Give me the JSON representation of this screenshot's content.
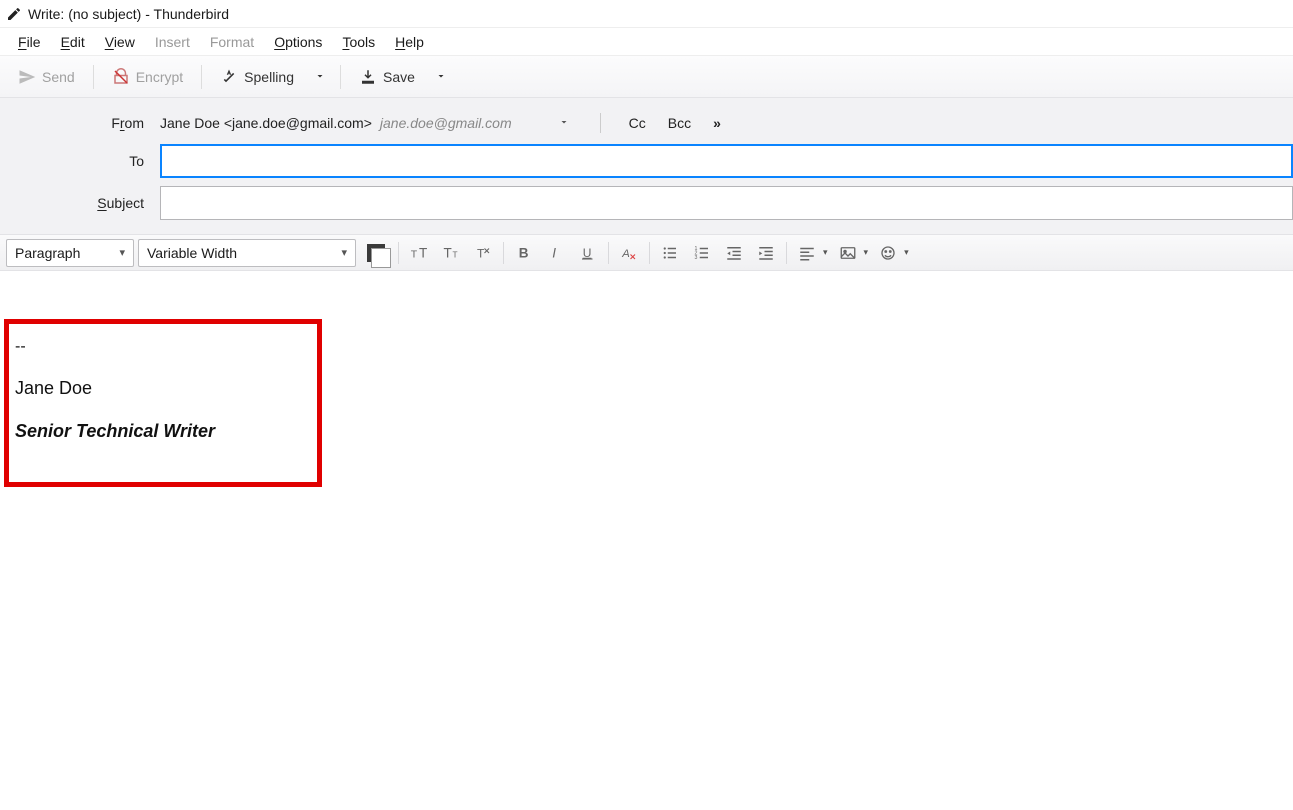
{
  "window": {
    "title": "Write: (no subject) - Thunderbird"
  },
  "menubar": {
    "file": "File",
    "edit": "Edit",
    "view": "View",
    "insert": "Insert",
    "format": "Format",
    "options": "Options",
    "tools": "Tools",
    "help": "Help"
  },
  "toolbar": {
    "send": "Send",
    "encrypt": "Encrypt",
    "spelling": "Spelling",
    "save": "Save"
  },
  "header": {
    "from_label": "From",
    "from_identity": "Jane Doe <jane.doe@gmail.com>",
    "from_account": "jane.doe@gmail.com",
    "cc_label": "Cc",
    "bcc_label": "Bcc",
    "to_label": "To",
    "to_value": "",
    "subject_label": "Subject",
    "subject_value": ""
  },
  "format": {
    "paragraph_style": "Paragraph",
    "font_family": "Variable Width"
  },
  "body": {
    "signature_separator": "--",
    "signature_name": "Jane Doe",
    "signature_title": "Senior Technical Writer"
  }
}
